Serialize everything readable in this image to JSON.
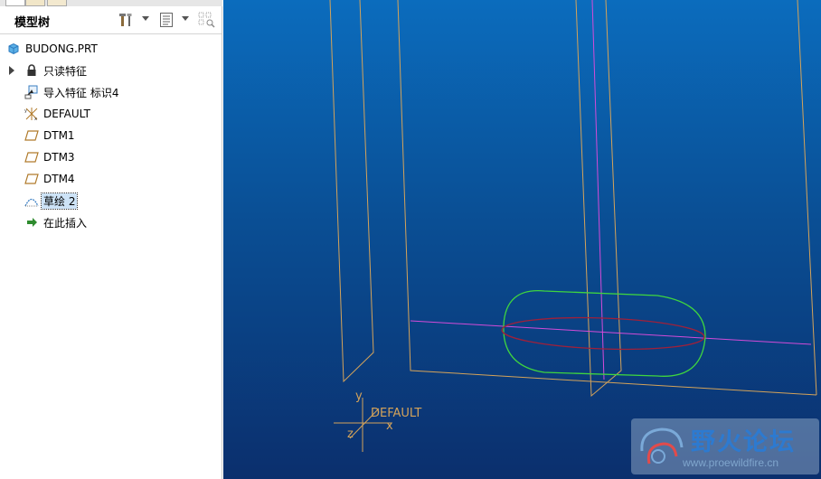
{
  "tree_panel": {
    "title": "模型树",
    "items": [
      {
        "label": "BUDONG.PRT",
        "icon": "part-icon"
      },
      {
        "label": "只读特征",
        "icon": "lock-icon",
        "expandable": true
      },
      {
        "label": "导入特征 标识4",
        "icon": "import-feature-icon"
      },
      {
        "label": "DEFAULT",
        "icon": "csys-icon"
      },
      {
        "label": "DTM1",
        "icon": "datum-plane-icon"
      },
      {
        "label": "DTM3",
        "icon": "datum-plane-icon"
      },
      {
        "label": "DTM4",
        "icon": "datum-plane-icon"
      },
      {
        "label": "草绘 2",
        "icon": "sketch-icon",
        "selected": true
      },
      {
        "label": "在此插入",
        "icon": "insert-here-arrow-icon"
      }
    ]
  },
  "viewport": {
    "csys_label": "DEFAULT",
    "csys_axis_x": "x",
    "csys_axis_y": "y",
    "csys_axis_z": "z",
    "csys_overlap_text": "DEF"
  },
  "watermark": {
    "title": "野火论坛",
    "url": "www.proewildfire.cn"
  },
  "colors": {
    "viewport_top": "#0b6cbd",
    "viewport_bottom": "#0b2f6d",
    "datum_plane": "#d4a35a",
    "axis_magenta": "#d34bd8",
    "sketch_green": "#3fd53f",
    "sketch_red": "#a0203a",
    "selection": "#cde3f7"
  }
}
